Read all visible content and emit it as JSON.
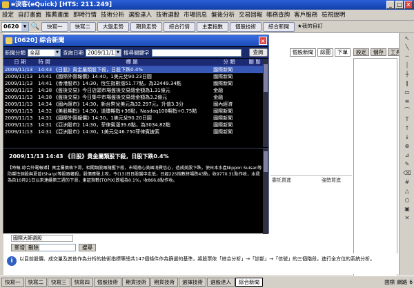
{
  "window": {
    "title": "e決客(eQuick) [HTS: 211.249]"
  },
  "menu": [
    "設定",
    "自訂畫面",
    "推薦畫面",
    "即時行情",
    "技術分析",
    "選股達人",
    "技術選股",
    "市場訊息",
    "盤後分析",
    "交易回報",
    "帳務查詢",
    "客戶服務",
    "檢視說明"
  ],
  "toolbar": {
    "stock_code": "0620",
    "buttons": [
      "快寫一",
      "快寫二",
      "大盤走勢",
      "期貨走勢",
      "綜合行情",
      "主要指數",
      "個股技術",
      "綜合新聞"
    ],
    "favorite": "我的自訂"
  },
  "news_window": {
    "title": "[0620] 綜合新聞",
    "filter": {
      "category_label": "新聞分類",
      "category_value": "全部",
      "date_label": "查詢日期",
      "date_value": "2009/11/13",
      "keyword_label": "搜尋關鍵字",
      "query_button": "查詢"
    },
    "columns": [
      "日 期",
      "時 間",
      "標  題",
      "分 類",
      "關 聯"
    ],
    "rows": [
      {
        "date": "2009/11/13",
        "time": "14:43",
        "headline": "《日股》貴金屬類股下殺，日股下跌0.4%",
        "category": "國際新聞",
        "selected": true
      },
      {
        "date": "2009/11/13",
        "time": "14:41",
        "headline": "《國際外匯報價》14:40，1美元兌90.23日圓",
        "category": "國際新聞",
        "selected": false
      },
      {
        "date": "2009/11/13",
        "time": "14:41",
        "headline": "《香港股市》14:30，恆生指數漲51.77點，為22449.34點",
        "category": "國際新聞",
        "selected": false
      },
      {
        "date": "2009/11/13",
        "time": "14:38",
        "headline": "《盤後交易》今日店頭市場盤後交易總金額為1.31億元",
        "category": "金融",
        "selected": false
      },
      {
        "date": "2009/11/13",
        "time": "14:38",
        "headline": "《盤後交易》今日集中市場盤後交易總金額為3.2億元",
        "category": "金融",
        "selected": false
      },
      {
        "date": "2009/11/13",
        "time": "14:34",
        "headline": "《國內匯市》14:30，新台幣兌美元為32.297元，升值3.3分",
        "category": "國內經濟",
        "selected": false
      },
      {
        "date": "2009/11/13",
        "time": "14:32",
        "headline": "《美股期指》14:30，道瓊期指+36點，Nasdaq100期指+0.75點",
        "category": "國際新聞",
        "selected": false
      },
      {
        "date": "2009/11/13",
        "time": "14:31",
        "headline": "《國際外匯報價》14:30，1美元兌90.20日圓",
        "category": "國際新聞",
        "selected": false
      },
      {
        "date": "2009/11/13",
        "time": "14:31",
        "headline": "《亞洲股市》14:30，菲律賓漲39.6點，為3034.82點",
        "category": "國際新聞",
        "selected": false
      },
      {
        "date": "2009/11/13",
        "time": "14:31",
        "headline": "《亞洲股市》14:30，1美元兌46.750菲律賓披索",
        "category": "國際新聞",
        "selected": false
      }
    ],
    "detail": {
      "headline": "2009/11/13  14:43  《日股》貴金屬類股下殺，日股下跌0.4%",
      "body": "【時報-綜合外電報導】貴金屬價格下滑，相關類股跟隨壓下殺，市場擔心美國消費信心，造成美股下跌，使日本水產Nippon Suisan等防禦性個股與夏普(Sharp)等股跟著殺，股價應聲上攻，今(13)日日股盤中走低，日經225指數終場跌43點，收9770.31點作收，本週為自10月21日以來連續第三週的下滑，東証指數(TOPIX)跌幅為0.1%，收866.8點作收。"
    }
  },
  "right_panel": {
    "tabs": [
      "個股新聞",
      "綜圖",
      "下單"
    ],
    "side_buttons": [
      "設定",
      "儲存",
      "工具"
    ],
    "labels": [
      "委託買進",
      "強勢買進"
    ]
  },
  "lower_panel": {
    "field_value": "國際大師選股",
    "buttons": [
      "新增",
      "刪除",
      "搜尋"
    ]
  },
  "status_message": "以目前股價、成交量及其他作為分析的技術指標等總共147個條件作為篩選的基準，將股票依「綜合分析」→「診斷」→「信號」的三個階段，進行全方位的系統分析。",
  "taskbar": {
    "buttons": [
      "快寫一",
      "快寫二",
      "快寫三",
      "快寫四",
      "個股技術",
      "期貨技術",
      "期貨技術",
      "選擇技術",
      "選股達人",
      "綜合新聞"
    ],
    "active": 9,
    "right": [
      "國際",
      "網路",
      "6"
    ]
  },
  "colors": {
    "news_bg": "#000000",
    "header_bg": "#1c2a74",
    "selected_row": "#3858b8",
    "title_bar": "#1a4ab8"
  }
}
